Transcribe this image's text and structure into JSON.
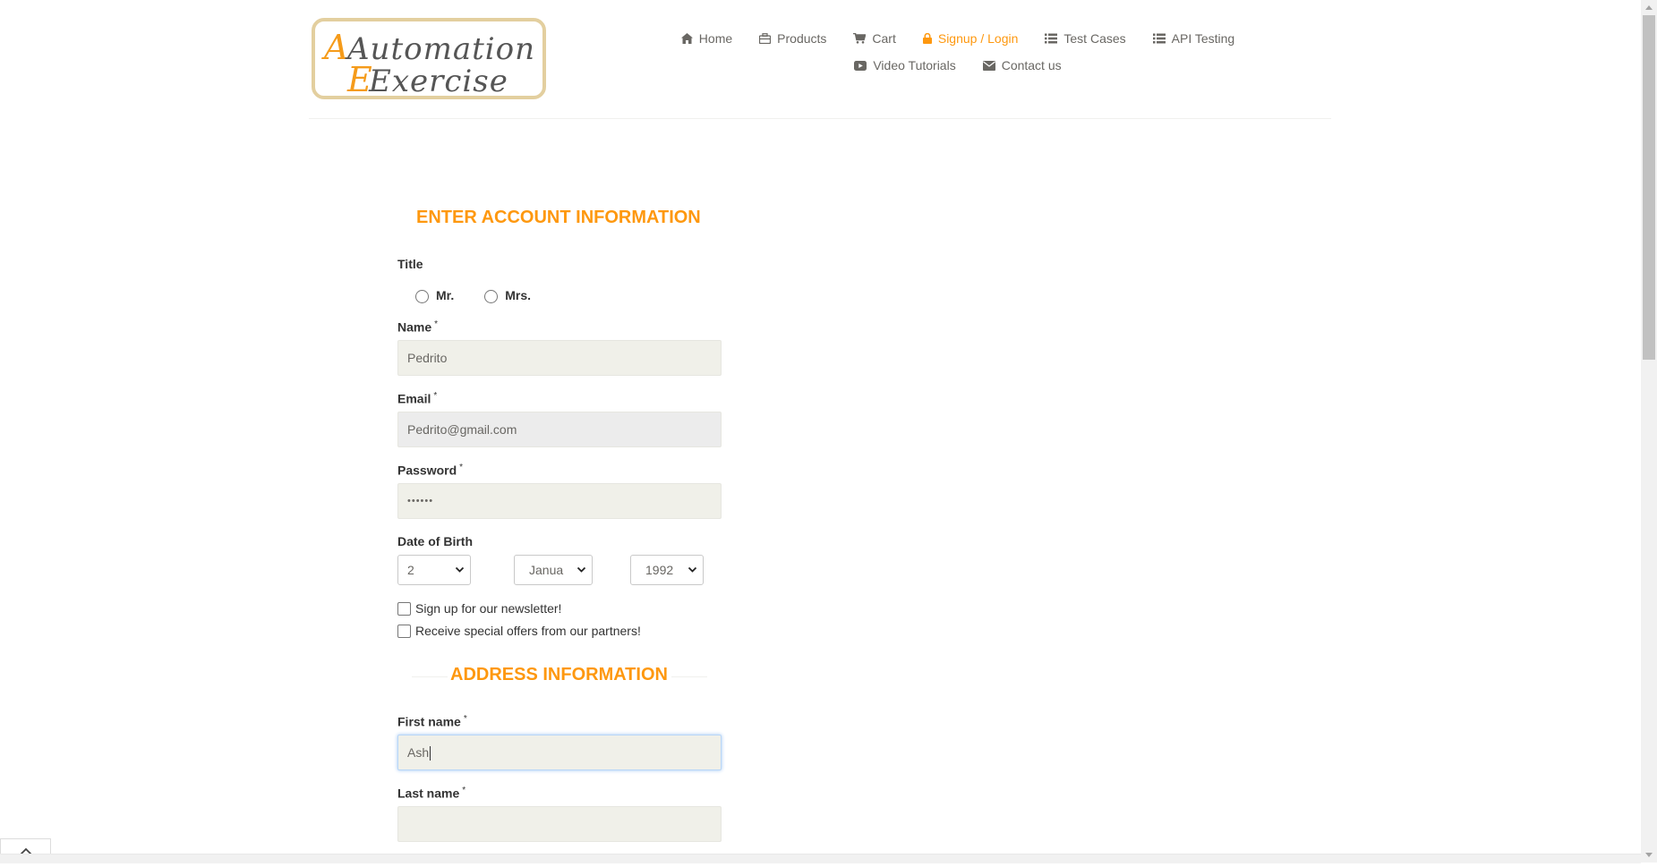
{
  "logo": {
    "line1": "Automation",
    "line2": "Exercise"
  },
  "nav": {
    "row1": [
      {
        "label": "Home",
        "icon": "home-icon",
        "active": false
      },
      {
        "label": "Products",
        "icon": "briefcase-icon",
        "active": false
      },
      {
        "label": "Cart",
        "icon": "cart-icon",
        "active": false
      },
      {
        "label": "Signup / Login",
        "icon": "lock-icon",
        "active": true
      },
      {
        "label": "Test Cases",
        "icon": "list-icon",
        "active": false
      },
      {
        "label": "API Testing",
        "icon": "list-icon",
        "active": false
      }
    ],
    "row2": [
      {
        "label": "Video Tutorials",
        "icon": "youtube-icon"
      },
      {
        "label": "Contact us",
        "icon": "envelope-icon"
      }
    ]
  },
  "account": {
    "heading": "ENTER ACCOUNT INFORMATION",
    "title_label": "Title",
    "title_options": [
      "Mr.",
      "Mrs."
    ],
    "name_label": "Name",
    "name_value": "Pedrito",
    "email_label": "Email",
    "email_value": "Pedrito@gmail.com",
    "password_label": "Password",
    "password_value": "••••••",
    "dob_label": "Date of Birth",
    "dob_day": "2",
    "dob_month": "Janua",
    "dob_year": "1992",
    "newsletter_label": "Sign up for our newsletter!",
    "offers_label": "Receive special offers from our partners!"
  },
  "address": {
    "heading": "ADDRESS INFORMATION",
    "first_name_label": "First name",
    "first_name_value": "Ash",
    "last_name_label": "Last name",
    "last_name_value": ""
  },
  "required_mark": "*",
  "colors": {
    "accent": "#fe980f",
    "nav_text": "#696763",
    "input_bg": "#f0f0e9"
  }
}
